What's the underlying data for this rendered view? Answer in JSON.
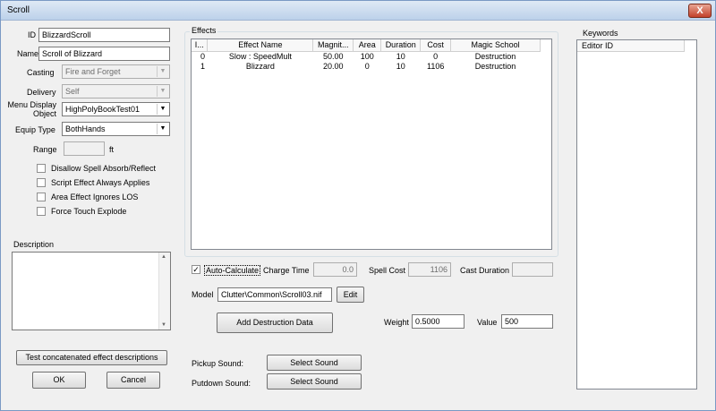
{
  "window": {
    "title": "Scroll",
    "close_glyph": "X"
  },
  "left": {
    "id_label": "ID",
    "id_value": "BlizzardScroll",
    "name_label": "Name",
    "name_value": "Scroll of Blizzard",
    "casting_label": "Casting",
    "casting_value": "Fire and Forget",
    "delivery_label": "Delivery",
    "delivery_value": "Self",
    "menu_display_label_1": "Menu Display",
    "menu_display_label_2": "Object",
    "menu_display_value": "HighPolyBookTest01",
    "equip_label": "Equip Type",
    "equip_value": "BothHands",
    "range_label": "Range",
    "range_value": "",
    "range_unit": "ft",
    "checkboxes": [
      {
        "label": "Disallow Spell Absorb/Reflect",
        "checked": false
      },
      {
        "label": "Script Effect Always Applies",
        "checked": false
      },
      {
        "label": "Area Effect Ignores LOS",
        "checked": false
      },
      {
        "label": "Force Touch Explode",
        "checked": false
      }
    ],
    "description_label": "Description",
    "description_value": "",
    "test_button": "Test concatenated effect descriptions",
    "ok_button": "OK",
    "cancel_button": "Cancel"
  },
  "effects": {
    "group_label": "Effects",
    "columns": [
      "I...",
      "Effect Name",
      "Magnit...",
      "Area",
      "Duration",
      "Cost",
      "Magic School"
    ],
    "rows": [
      [
        "0",
        "Slow : SpeedMult",
        "50.00",
        "100",
        "10",
        "0",
        "Destruction"
      ],
      [
        "1",
        "Blizzard",
        "20.00",
        "0",
        "10",
        "1106",
        "Destruction"
      ]
    ]
  },
  "middle": {
    "auto_calc_label": "Auto-Calculate",
    "auto_calc_checked": true,
    "charge_time_label": "Charge Time",
    "charge_time_value": "0.0",
    "spell_cost_label": "Spell Cost",
    "spell_cost_value": "1106",
    "cast_duration_label": "Cast Duration",
    "cast_duration_value": "",
    "model_label": "Model",
    "model_value": "Clutter\\Common\\Scroll03.nif",
    "edit_button": "Edit",
    "add_destruction_button": "Add Destruction Data",
    "weight_label": "Weight",
    "weight_value": "0.5000",
    "value_label": "Value",
    "value_value": "500",
    "pickup_label": "Pickup Sound:",
    "pickup_button": "Select Sound",
    "putdown_label": "Putdown Sound:",
    "putdown_button": "Select Sound"
  },
  "keywords": {
    "label": "Keywords",
    "column": "Editor ID"
  }
}
